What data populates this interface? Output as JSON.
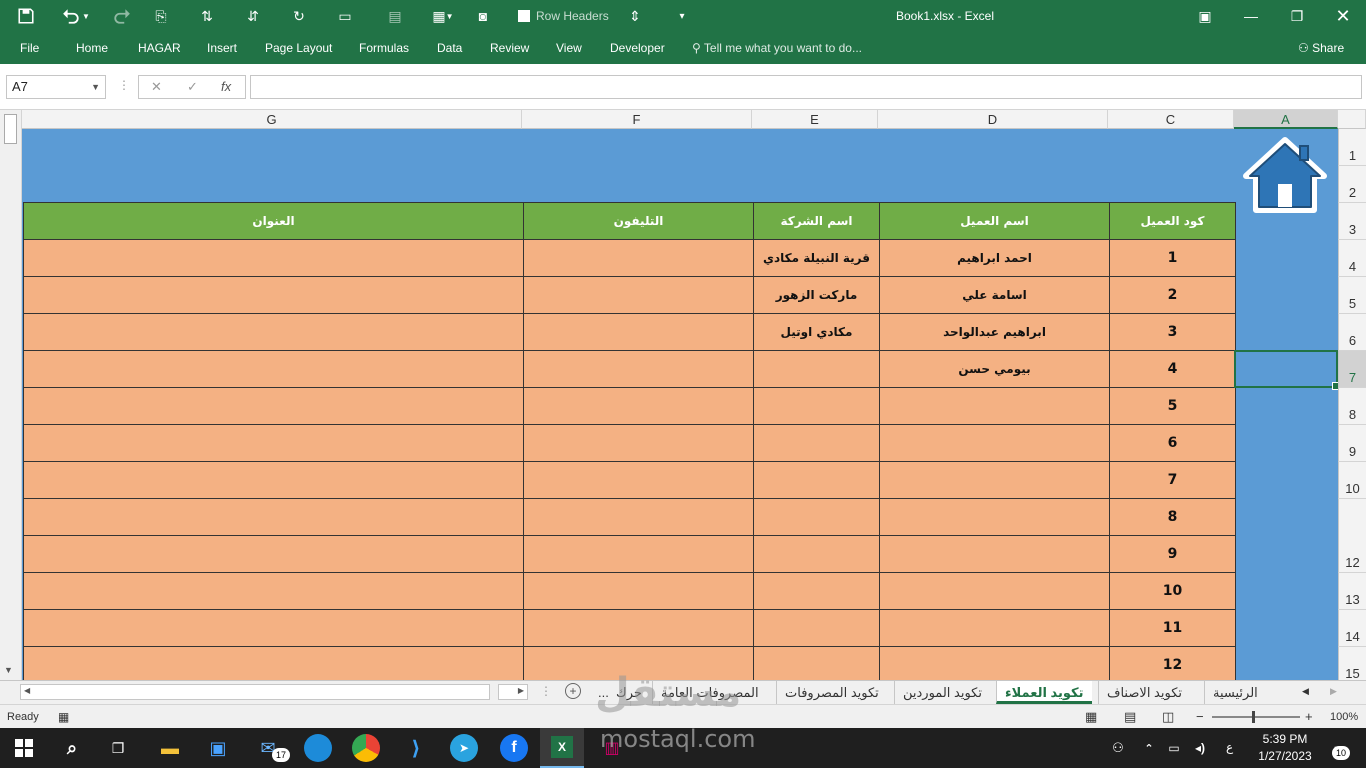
{
  "titlebar": {
    "title": "Book1.xlsx  -  Excel",
    "row_headers_label": "Row Headers"
  },
  "ribbon": {
    "tabs": [
      "File",
      "Home",
      "HAGAR",
      "Insert",
      "Page Layout",
      "Formulas",
      "Data",
      "Review",
      "View",
      "Developer"
    ],
    "tell_me": "Tell me what you want to do...",
    "share": "Share"
  },
  "formula_bar": {
    "name_box": "A7",
    "fx": "fx",
    "value": ""
  },
  "columns": [
    "G",
    "F",
    "E",
    "D",
    "C",
    "A"
  ],
  "rows": [
    "1",
    "2",
    "3",
    "4",
    "5",
    "6",
    "7",
    "8",
    "9",
    "10",
    "12",
    "13",
    "14",
    "15"
  ],
  "table": {
    "headers": [
      "كود العميل",
      "اسم العميل",
      "اسم الشركة",
      "التليفون",
      "العنوان"
    ],
    "rows": [
      [
        "1",
        "احمد ابراهيم",
        "قرية النبيلة مكادي",
        "",
        ""
      ],
      [
        "2",
        "اسامة علي",
        "ماركت الزهور",
        "",
        ""
      ],
      [
        "3",
        "ابراهيم عبدالواحد",
        "مكادي اوتيل",
        "",
        ""
      ],
      [
        "4",
        "بيومي حسن",
        "",
        "",
        ""
      ],
      [
        "5",
        "",
        "",
        "",
        ""
      ],
      [
        "6",
        "",
        "",
        "",
        ""
      ],
      [
        "7",
        "",
        "",
        "",
        ""
      ],
      [
        "8",
        "",
        "",
        "",
        ""
      ],
      [
        "9",
        "",
        "",
        "",
        ""
      ],
      [
        "10",
        "",
        "",
        "",
        ""
      ],
      [
        "11",
        "",
        "",
        "",
        ""
      ],
      [
        "12",
        "",
        "",
        "",
        ""
      ]
    ]
  },
  "sheet_tabs": {
    "items": [
      "الرئيسية",
      "تكويد الاصناف",
      "تكويد العملاء",
      "تكويد الموردين",
      "تكويد المصروفات",
      "المصروفات العامة",
      "حرك",
      "..."
    ],
    "active": "تكويد العملاء"
  },
  "statusbar": {
    "status": "Ready",
    "zoom": "100%"
  },
  "taskbar": {
    "time": "5:39 PM",
    "date": "1/27/2023",
    "lang": "ع",
    "mail_badge": "17",
    "notif_badge": "10"
  },
  "watermark": {
    "text": "مستقل",
    "url": "mostaql.com"
  },
  "colors": {
    "excel_green": "#217346",
    "header_green": "#70ad47",
    "cell_orange": "#f4b183",
    "sheet_blue": "#5b9bd5"
  }
}
